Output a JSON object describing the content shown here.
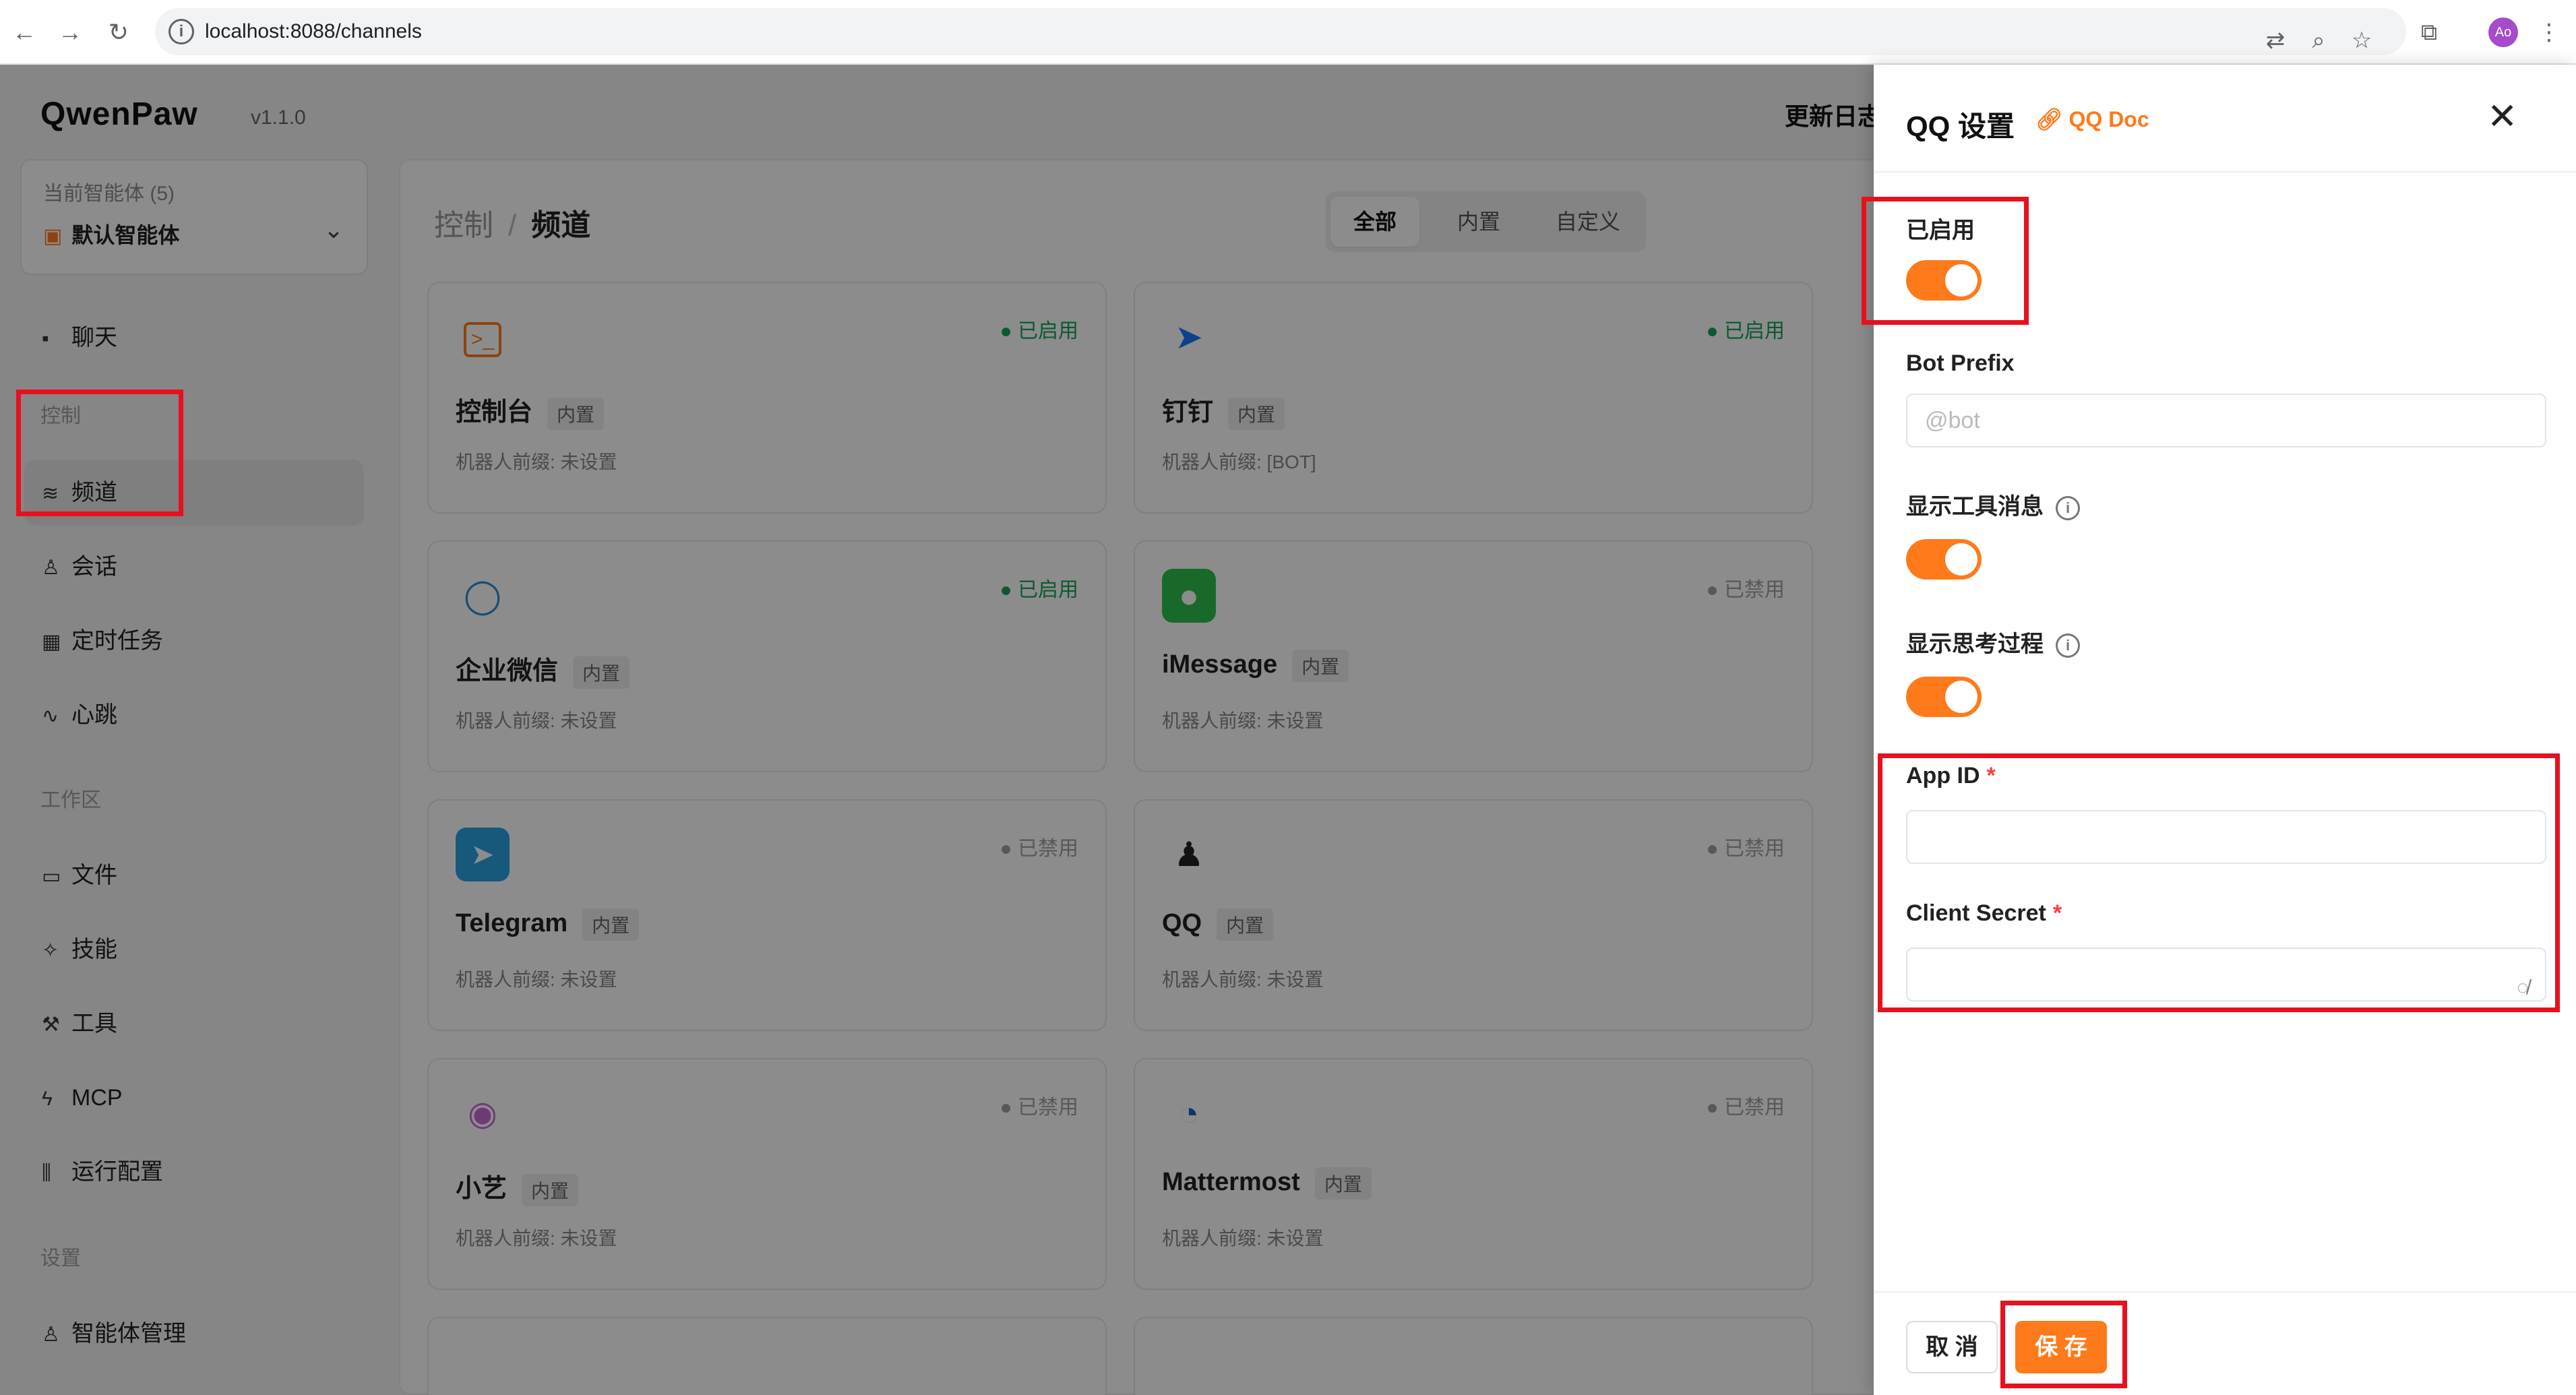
{
  "browser": {
    "url": "localhost:8088/channels",
    "profile_initials": "Ao",
    "back_icon": "←",
    "forward_icon": "→",
    "reload_icon": "↻"
  },
  "app": {
    "logo": "QwenPaw",
    "version": "v1.1.0",
    "header_link": "更新日志"
  },
  "agent_selector": {
    "count_label": "当前智能体 (5)",
    "current": "默认智能体"
  },
  "sidebar": {
    "chat": "聊天",
    "section_control": "控制",
    "channels": "频道",
    "sessions": "会话",
    "cron": "定时任务",
    "heartbeat": "心跳",
    "section_workspace": "工作区",
    "files": "文件",
    "skills": "技能",
    "tools": "工具",
    "mcp": "MCP",
    "runtime": "运行配置",
    "section_settings": "设置",
    "agent_mgmt": "智能体管理"
  },
  "main": {
    "breadcrumb_parent": "控制",
    "breadcrumb_current": "频道",
    "tabs": [
      "全部",
      "内置",
      "自定义"
    ],
    "tag_builtin": "内置",
    "cards": [
      {
        "name": "控制台",
        "status": "已启用",
        "desc": "机器人前缀: 未设置"
      },
      {
        "name": "钉钉",
        "status": "已启用",
        "desc": "机器人前缀: [BOT]"
      },
      {
        "name": "企业微信",
        "status": "已启用",
        "desc": "机器人前缀: 未设置"
      },
      {
        "name": "iMessage",
        "status": "已禁用",
        "desc": "机器人前缀: 未设置"
      },
      {
        "name": "Telegram",
        "status": "已禁用",
        "desc": "机器人前缀: 未设置"
      },
      {
        "name": "QQ",
        "status": "已禁用",
        "desc": "机器人前缀: 未设置"
      },
      {
        "name": "小艺",
        "status": "已禁用",
        "desc": "机器人前缀: 未设置"
      },
      {
        "name": "Mattermost",
        "status": "已禁用",
        "desc": "机器人前缀: 未设置"
      }
    ]
  },
  "drawer": {
    "title": "QQ 设置",
    "doc_link": "QQ Doc",
    "enabled_label": "已启用",
    "bot_prefix_label": "Bot Prefix",
    "bot_prefix_placeholder": "@bot",
    "show_tool_label": "显示工具消息",
    "show_thinking_label": "显示思考过程",
    "app_id_label": "App ID",
    "client_secret_label": "Client Secret",
    "required_mark": "*",
    "cancel": "取 消",
    "save": "保 存"
  },
  "colors": {
    "accent": "#ff7a1a",
    "enabled": "#15a35c",
    "highlight": "#e8101e"
  }
}
